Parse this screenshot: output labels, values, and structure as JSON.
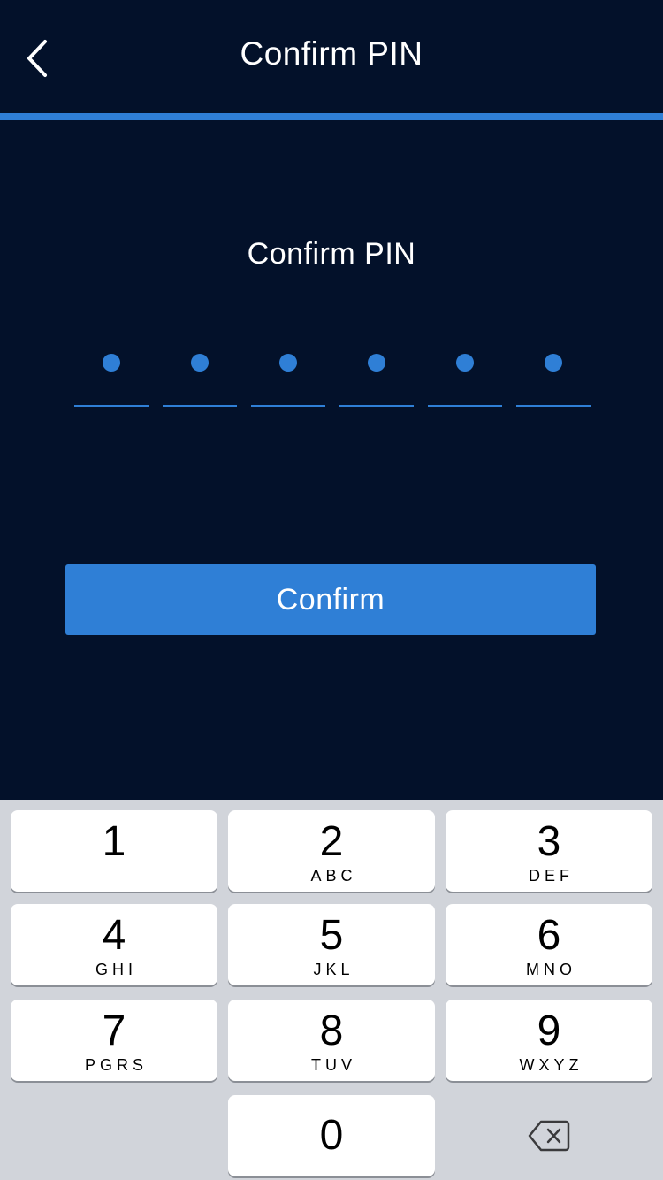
{
  "header": {
    "title": "Confirm PIN",
    "back_icon": "chevron-left-icon"
  },
  "pin": {
    "prompt": "Confirm PIN",
    "length": 6,
    "filled": 6
  },
  "actions": {
    "confirm_label": "Confirm"
  },
  "keypad": {
    "keys": [
      {
        "digit": "1",
        "letters": ""
      },
      {
        "digit": "2",
        "letters": "ABC"
      },
      {
        "digit": "3",
        "letters": "DEF"
      },
      {
        "digit": "4",
        "letters": "GHI"
      },
      {
        "digit": "5",
        "letters": "JKL"
      },
      {
        "digit": "6",
        "letters": "MNO"
      },
      {
        "digit": "7",
        "letters": "PGRS"
      },
      {
        "digit": "8",
        "letters": "TUV"
      },
      {
        "digit": "9",
        "letters": "WXYZ"
      },
      {
        "digit": "0",
        "letters": ""
      }
    ],
    "delete_icon": "backspace-icon"
  },
  "colors": {
    "background": "#03112a",
    "accent": "#2f7fd6",
    "keypad_background": "#d1d4da",
    "key_background": "#ffffff"
  }
}
